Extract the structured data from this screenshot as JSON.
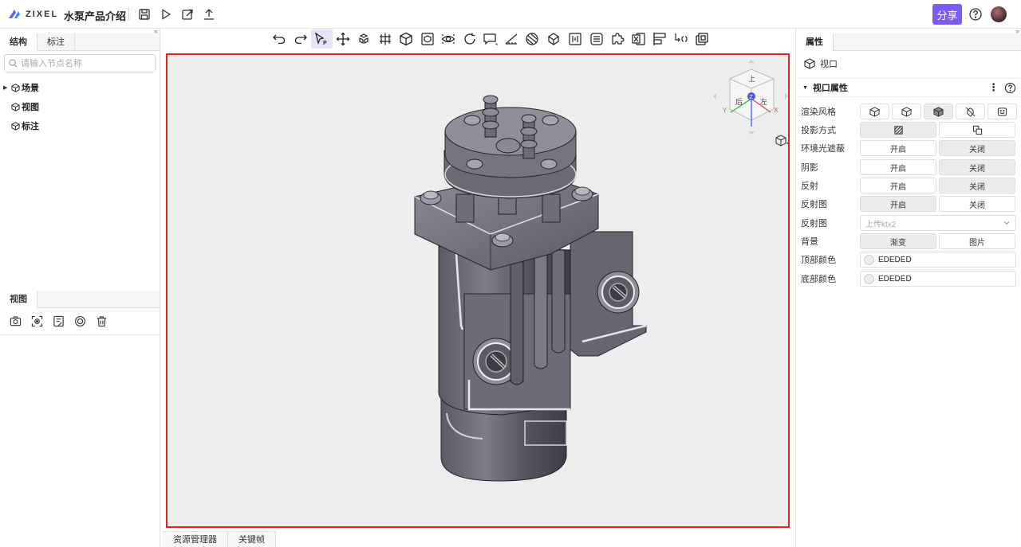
{
  "header": {
    "logo_text": "ZIXEL",
    "doc_title": "水泵产品介绍",
    "share_label": "分享",
    "icons": [
      "save-icon",
      "play-icon",
      "edit-export-icon",
      "upload-icon",
      "help-icon"
    ]
  },
  "left_panel": {
    "tabs": [
      {
        "label": "结构"
      },
      {
        "label": "标注"
      }
    ],
    "search": {
      "placeholder": "请输入节点名称",
      "value": ""
    },
    "tree": [
      {
        "label": "场景"
      },
      {
        "label": "视图"
      },
      {
        "label": "标注"
      }
    ],
    "view_tab": {
      "label": "视图"
    },
    "view_tools": [
      "camera-icon",
      "focus-icon",
      "note-icon",
      "circle-icon",
      "trash-icon"
    ]
  },
  "toolbar": {
    "icons": [
      "undo-icon",
      "redo-icon",
      "select-icon",
      "move-icon",
      "explode-icon",
      "section-icon",
      "cube-icon",
      "box-icon",
      "eye-icon",
      "rotate-icon",
      "comment-icon",
      "measure-icon",
      "material-icon",
      "light-icon",
      "gauge-icon",
      "list-icon",
      "puzzle-icon",
      "excel-icon",
      "align-icon",
      "dimension-icon",
      "layers-icon"
    ],
    "active_index": 2
  },
  "viewport": {
    "border_color": "#e02424",
    "background": "#ededed",
    "gizmo": {
      "z_label": "Z",
      "y_label": "Y",
      "x_label": "X",
      "top_face": "上",
      "left_face": "后",
      "right_face": "左"
    }
  },
  "bottom_tabs": [
    {
      "label": "资源管理器"
    },
    {
      "label": "关键帧"
    }
  ],
  "right_panel": {
    "tab": "属性",
    "object_label": "视口",
    "section_label": "视口属性",
    "rows": {
      "render_style": {
        "label": "渲染风格",
        "icons": [
          "shaded-edge-icon",
          "wireframe-icon",
          "shaded-icon",
          "hidden-icon",
          "face-icon"
        ],
        "active_index": 2
      },
      "projection": {
        "label": "投影方式",
        "icons": [
          "perspective-icon",
          "orthographic-icon"
        ],
        "active_index": 0
      },
      "ambient_occlusion": {
        "label": "环境光遮蔽",
        "options": [
          "开启",
          "关闭"
        ],
        "active_index": 1
      },
      "shadow": {
        "label": "阴影",
        "options": [
          "开启",
          "关闭"
        ],
        "active_index": 1
      },
      "reflection": {
        "label": "反射",
        "options": [
          "开启",
          "关闭"
        ],
        "active_index": 1
      },
      "reflection_map_toggle": {
        "label": "反射图",
        "options": [
          "开启",
          "关闭"
        ],
        "active_index": 0
      },
      "reflection_map": {
        "label": "反射图",
        "placeholder": "上传ktx2"
      },
      "background": {
        "label": "背景",
        "options": [
          "渐变",
          "图片"
        ],
        "active_index": 0
      },
      "top_color": {
        "label": "顶部颜色",
        "value": "EDEDED",
        "swatch": "#EDEDED"
      },
      "bottom_color": {
        "label": "底部颜色",
        "value": "EDEDED",
        "swatch": "#EDEDED"
      }
    }
  },
  "colors": {
    "accent": "#7b5cf5",
    "selection": "#e02424"
  }
}
